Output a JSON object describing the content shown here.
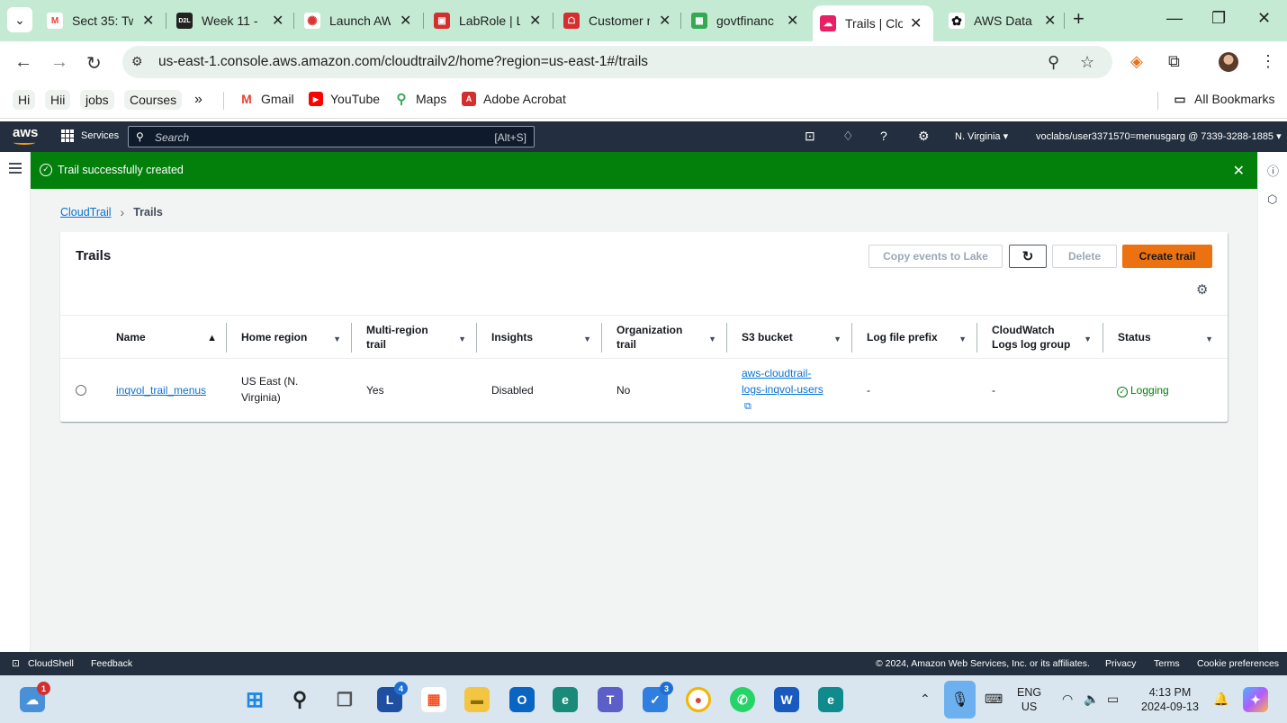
{
  "browser": {
    "tabs": [
      {
        "title": "Sect 35: Tw",
        "fav_color": "#ffffff",
        "fav_text": "M",
        "fav_fg": "#ea4335"
      },
      {
        "title": "Week 11 -",
        "fav_color": "#222222",
        "fav_text": "D2L",
        "fav_fg": "#ffffff"
      },
      {
        "title": "Launch AW",
        "fav_color": "#ffffff",
        "fav_text": "✺",
        "fav_fg": "#d33"
      },
      {
        "title": "LabRole | L",
        "fav_color": "#d32f2f",
        "fav_text": "▣",
        "fav_fg": "#ffffff"
      },
      {
        "title": "Customer r",
        "fav_color": "#d32f2f",
        "fav_text": "☖",
        "fav_fg": "#ffffff"
      },
      {
        "title": "govtfinanc",
        "fav_color": "#34a853",
        "fav_text": "▦",
        "fav_fg": "#ffffff"
      },
      {
        "title": "Trails | Clo",
        "fav_color": "#e91e63",
        "fav_text": "☁",
        "fav_fg": "#ffffff",
        "active": true
      },
      {
        "title": "AWS Data",
        "fav_color": "#ffffff",
        "fav_text": "✿",
        "fav_fg": "#111111"
      }
    ],
    "url": "us-east-1.console.aws.amazon.com/cloudtrailv2/home?region=us-east-1#/trails",
    "bookmarks": {
      "chips": [
        "Hi",
        "Hii",
        "jobs",
        "Courses"
      ],
      "more": "»",
      "items": [
        "Gmail",
        "YouTube",
        "Maps",
        "Adobe Acrobat"
      ],
      "all": "All Bookmarks"
    }
  },
  "aws": {
    "logo": "aws",
    "services": "Services",
    "search_placeholder": "Search",
    "search_shortcut": "[Alt+S]",
    "region": "N. Virginia ▾",
    "account": "voclabs/user3371570=menusgarg @ 7339-3288-1885 ▾",
    "flash": "Trail successfully created",
    "breadcrumb": {
      "root": "CloudTrail",
      "current": "Trails"
    },
    "panel": {
      "title": "Trails",
      "buttons": {
        "copy": "Copy events to Lake",
        "delete": "Delete",
        "create": "Create trail"
      }
    },
    "columns": [
      "Name",
      "Home region",
      "Multi-region trail",
      "Insights",
      "Organization trail",
      "S3 bucket",
      "Log file prefix",
      "CloudWatch Logs log group",
      "Status"
    ],
    "row": {
      "name": "inqvol_trail_menus",
      "home_region": "US East (N. Virginia)",
      "multi_region": "Yes",
      "insights": "Disabled",
      "organization": "No",
      "s3_bucket": "aws-cloudtrail-logs-inqvol-users",
      "log_prefix": "-",
      "cw_logs": "-",
      "status": "Logging"
    },
    "footer": {
      "cloudshell": "CloudShell",
      "feedback": "Feedback",
      "copyright": "© 2024, Amazon Web Services, Inc. or its affiliates.",
      "privacy": "Privacy",
      "terms": "Terms",
      "cookies": "Cookie preferences"
    }
  },
  "taskbar": {
    "lang_top": "ENG",
    "lang_bottom": "US",
    "time": "4:13 PM",
    "date": "2024-09-13",
    "badges": {
      "weather": "1",
      "l": "4",
      "todo": "3"
    }
  }
}
